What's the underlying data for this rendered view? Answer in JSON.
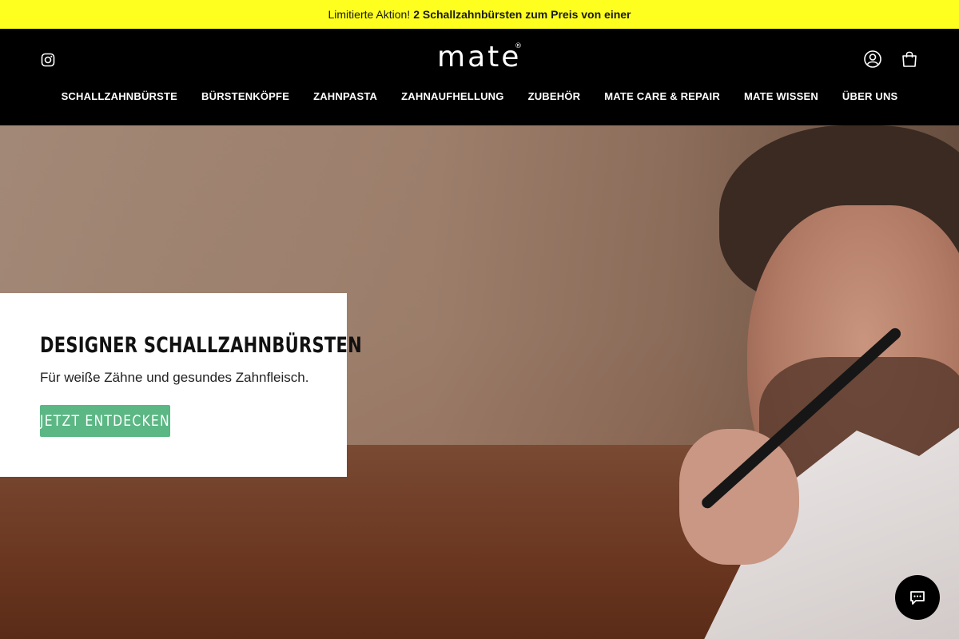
{
  "announcement": {
    "lead": "Limitierte Aktion!",
    "highlight": "2 Schallzahnbürsten zum Preis von einer"
  },
  "header": {
    "logo": "mate",
    "logo_mark": "®",
    "icons": {
      "social": "instagram-icon",
      "account": "account-icon",
      "cart": "cart-icon"
    }
  },
  "nav": {
    "items": [
      "SCHALLZAHNBÜRSTE",
      "BÜRSTENKÖPFE",
      "ZAHNPASTA",
      "ZAHNAUFHELLUNG",
      "ZUBEHÖR",
      "MATE CARE & REPAIR",
      "MATE WISSEN",
      "ÜBER UNS"
    ]
  },
  "hero": {
    "title": "DESIGNER SCHALLZAHNBÜRSTEN",
    "subtitle": "Für weiße Zähne und gesundes Zahnfleisch.",
    "cta": "JETZT ENTDECKEN"
  },
  "chat": {
    "icon": "chat-icon"
  },
  "colors": {
    "announcement_bg": "#ffff1f",
    "header_bg": "#000000",
    "cta_bg": "#5bb784",
    "card_bg": "#ffffff"
  }
}
